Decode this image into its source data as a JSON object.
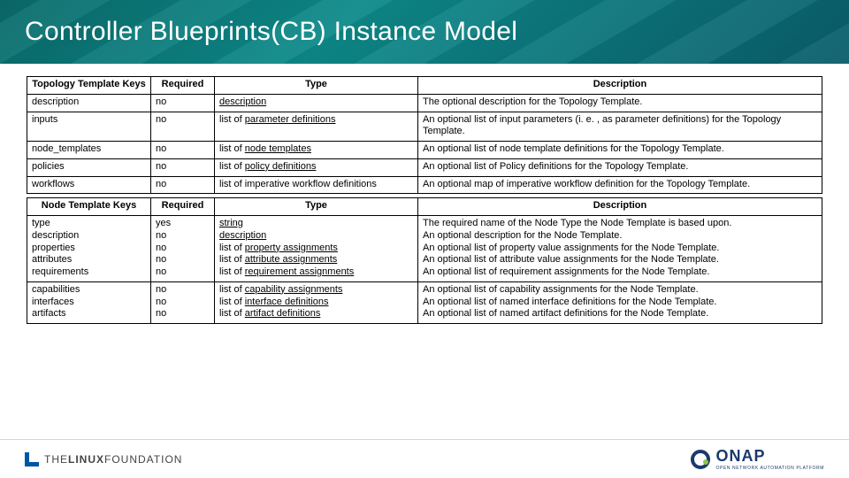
{
  "page": {
    "title": "Controller Blueprints(CB) Instance Model"
  },
  "table1": {
    "headers": {
      "key": "Topology Template Keys",
      "required": "Required",
      "type": "Type",
      "description": "Description"
    },
    "rows": [
      {
        "key": "description",
        "required": "no",
        "type_prefix": "",
        "type_link": "description",
        "desc": "The optional description for the Topology Template."
      },
      {
        "key": "inputs",
        "required": "no",
        "type_prefix": "list of ",
        "type_link": "parameter definitions",
        "desc": "An optional list of input parameters (i. e. , as parameter definitions) for the Topology Template."
      },
      {
        "key": "node_templates",
        "required": "no",
        "type_prefix": "list of  ",
        "type_link": "node templates",
        "desc": "An optional list of node template definitions for the Topology Template."
      },
      {
        "key": "policies",
        "required": "no",
        "type_prefix": "list of ",
        "type_link": "policy definitions",
        "desc": "An optional list of Policy definitions for the Topology Template."
      },
      {
        "key": "workflows",
        "required": "no",
        "type_prefix": "",
        "type_plain": "list of imperative workflow definitions",
        "desc": "An optional map of imperative workflow definition for the Topology Template."
      }
    ]
  },
  "table2": {
    "headers": {
      "key": "Node Template Keys",
      "required": "Required",
      "type": "Type",
      "description": "Description"
    },
    "rowsA": [
      {
        "key": "type",
        "required": "yes",
        "type_prefix": "",
        "type_link": "string",
        "desc": "The required name of the Node Type the Node Template is based upon."
      },
      {
        "key": "description",
        "required": "no",
        "type_prefix": "",
        "type_link": "description",
        "desc": "An optional description for the Node Template."
      },
      {
        "key": "properties",
        "required": "no",
        "type_prefix": "list of ",
        "type_link": "property assignments",
        "desc": "An optional list of property value assignments for the Node Template."
      },
      {
        "key": "attributes",
        "required": "no",
        "type_prefix": "list of ",
        "type_link": "attribute assignments",
        "desc": "An optional list of attribute value assignments for the Node Template."
      },
      {
        "key": "requirements",
        "required": "no",
        "type_prefix": "list of ",
        "type_link": "requirement assignments",
        "desc": "An optional list of requirement assignments for the Node Template."
      }
    ],
    "rowsB": [
      {
        "key": "capabilities",
        "required": "no",
        "type_prefix": "list of ",
        "type_link": "capability assignments",
        "desc": "An optional list of capability assignments for the Node Template."
      },
      {
        "key": "interfaces",
        "required": "no",
        "type_prefix": "list of ",
        "type_link": "interface definitions",
        "desc": "An optional list of named interface definitions for the Node Template."
      },
      {
        "key": "artifacts",
        "required": "no",
        "type_prefix": "list of ",
        "type_link": "artifact definitions",
        "desc": "An optional list of named artifact definitions for the Node Template."
      }
    ]
  },
  "footer": {
    "linux_text_1": "THE",
    "linux_text_2": "LINUX",
    "linux_text_3": "FOUNDATION",
    "onap_text": "ONAP",
    "onap_sub": "OPEN NETWORK AUTOMATION PLATFORM"
  }
}
